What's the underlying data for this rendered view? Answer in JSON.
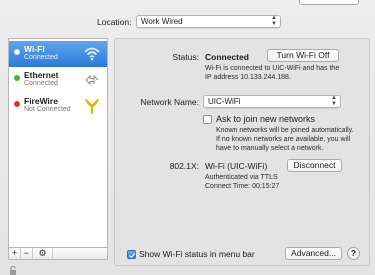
{
  "location": {
    "label": "Location:",
    "value": "Work Wired"
  },
  "services": [
    {
      "name": "Wi-Fi",
      "status": "Connected",
      "dot_color": "#ffffff",
      "icon": "wifi-icon"
    },
    {
      "name": "Ethernet",
      "status": "Connected",
      "dot_color": "#3fb63f",
      "icon": "ethernet-arrows-icon"
    },
    {
      "name": "FireWire",
      "status": "Not Connected",
      "dot_color": "#d93a2f",
      "icon": "firewire-icon"
    }
  ],
  "sidebar_tools": {
    "add": "+",
    "remove": "−",
    "gear": "⚙"
  },
  "detail": {
    "status_label": "Status:",
    "status_value": "Connected",
    "turn_off_button": "Turn Wi-Fi Off",
    "status_desc_line1": "Wi-Fi is connected to UIC-WiFi and has the",
    "status_desc_line2": "IP address 10.133.244.188.",
    "network_name_label": "Network Name:",
    "network_name_value": "UIC-WiFi",
    "ask_join_label": "Ask to join new networks",
    "ask_join_checked": false,
    "ask_desc_line1": "Known networks will be joined automatically.",
    "ask_desc_line2": "If no known networks are available, you will",
    "ask_desc_line3": "have to manually select a network.",
    "dot1x_label": "802.1X:",
    "dot1x_value": "Wi-Fi (UIC-WiFi)",
    "disconnect_button": "Disconnect",
    "auth_line1": "Authenticated via TTLS",
    "auth_line2": "Connect Time: 00:15:27",
    "show_status_label": "Show Wi-Fi status in menu bar",
    "show_status_checked": true,
    "advanced_button": "Advanced...",
    "help_button": "?"
  },
  "colors": {
    "selection": "#2d7ad8",
    "accent_check": "#2f7edb"
  }
}
